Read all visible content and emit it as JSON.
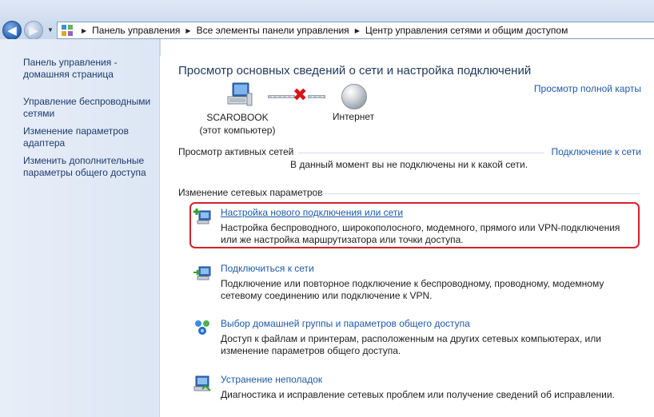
{
  "breadcrumb": {
    "items": [
      "Панель управления",
      "Все элементы панели управления",
      "Центр управления сетями и общим доступом"
    ]
  },
  "sidebar": {
    "items": [
      {
        "label": "Панель управления - домашняя страница"
      },
      {
        "label": "Управление беспроводными сетями"
      },
      {
        "label": "Изменение параметров адаптера"
      },
      {
        "label": "Изменить дополнительные параметры общего доступа"
      }
    ]
  },
  "main": {
    "title": "Просмотр основных сведений о сети и настройка подключений",
    "full_map_link": "Просмотр полной карты",
    "computer_name": "SCAROBOOK",
    "computer_sub": "(этот компьютер)",
    "internet_label": "Интернет",
    "active_networks_header": "Просмотр активных сетей",
    "connect_link": "Подключение к сети",
    "no_network_text": "В данный момент вы не подключены ни к какой сети.",
    "change_settings_header": "Изменение сетевых параметров",
    "tasks": [
      {
        "title": "Настройка нового подключения или сети",
        "description": "Настройка беспроводного, широкополосного, модемного, прямого или VPN-подключения или же настройка маршрутизатора или точки доступа.",
        "icon": "new-connection-icon"
      },
      {
        "title": "Подключиться к сети",
        "description": "Подключение или повторное подключение к беспроводному, проводному, модемному сетевому соединению или подключение к VPN.",
        "icon": "connect-network-icon"
      },
      {
        "title": "Выбор домашней группы и параметров общего доступа",
        "description": "Доступ к файлам и принтерам, расположенным на других сетевых компьютерах, или изменение параметров общего доступа.",
        "icon": "homegroup-icon"
      },
      {
        "title": "Устранение неполадок",
        "description": "Диагностика и исправление сетевых проблем или получение сведений об исправлении.",
        "icon": "troubleshoot-icon"
      }
    ]
  },
  "colors": {
    "link": "#1d5aab",
    "highlight_border": "#d3222a",
    "disconnect_mark": "#d8141a"
  }
}
